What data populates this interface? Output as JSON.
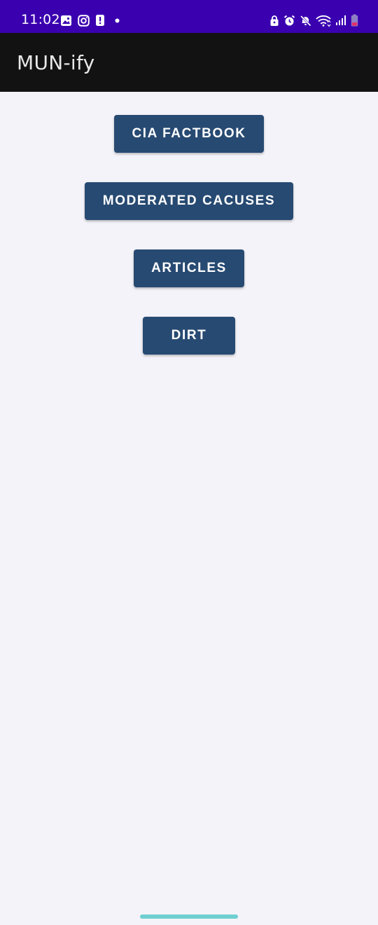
{
  "status_bar": {
    "time": "11:02",
    "background": "#3a00b0",
    "left_icons": [
      "gallery-icon",
      "instagram-icon",
      "alert-icon",
      "dot-icon"
    ],
    "right_icons": [
      "lock-icon",
      "alarm-icon",
      "mute-icon",
      "wifi-icon",
      "signal-icon",
      "battery-icon"
    ]
  },
  "app_bar": {
    "title": "MUN-ify",
    "background": "#121212"
  },
  "buttons": [
    {
      "label": "CIA FACTBOOK"
    },
    {
      "label": "MODERATED CACUSES"
    },
    {
      "label": "ARTICLES"
    },
    {
      "label": "DIRT"
    }
  ],
  "colors": {
    "button": "#274a72",
    "page_background": "#f3f3f9",
    "home_indicator": "#6fcfd1"
  }
}
